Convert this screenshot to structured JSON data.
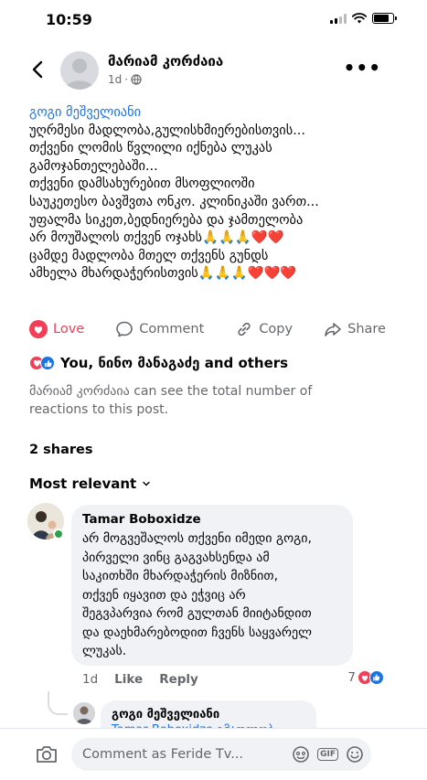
{
  "status_bar": {
    "time": "10:59"
  },
  "header": {
    "author": "მარიამ კორძაია",
    "age": "1d",
    "separator": "·"
  },
  "post": {
    "mention": "გოგი მეშველიანი",
    "lines": [
      "უღრმესი მადლობა,გულისხმიერებისთვის...",
      "თქვენი ლომის წვლილი იქნება ლუკას",
      "გამოჯანთელებაში...",
      "თქვენი დამსახურებით მსოფლიოში",
      "საუკეთესო ბავშვთა ონკო. კლინიკაში ვართ...",
      "უფალმა სიკეთ,ბედნიერება და ჯამთელობა",
      "არ მოუშალოს თქვენ ოჯახს🙏🙏🙏❤️❤️",
      "ცამდე მადლობა მთელ თქვენს გუნდს",
      "ამხელა მხარდაჭერისთვის🙏🙏🙏❤️❤️❤️"
    ]
  },
  "actions": {
    "love": "Love",
    "comment": "Comment",
    "copy": "Copy",
    "share": "Share"
  },
  "reactions": {
    "summary": "You, ნინო მანაგაძე and others",
    "note": "მარიამ კორძაია can see the total number of reactions to this post."
  },
  "shares": "2 shares",
  "sort": {
    "label": "Most relevant"
  },
  "comment": {
    "author": "Tamar Boboxidze",
    "lines": [
      "არ მოგვეშალოს თქვენი იმედი გოგი,",
      "პირველი ვინც გაგვახსენდა ამ",
      "საკითხში მხარდაჭერის მიზნით,",
      "თქვენ იყავით და ეჭვიც არ",
      "შეგვპარვია რომ გულთან მიიტანდით",
      "და დაეხმარებოდით ჩვენს საყვარელ",
      "ლუკას."
    ],
    "age": "1d",
    "like": "Like",
    "reply": "Reply",
    "reaction_count": "7"
  },
  "reply": {
    "author": "გოგი მეშველიანი",
    "text": "Tamar Boboxidze გმადლობ"
  },
  "composer": {
    "placeholder": "Comment as Feride Tv..."
  },
  "colors": {
    "accent": "#1b74e4",
    "love": "#f33e58",
    "muted": "#65676b"
  }
}
